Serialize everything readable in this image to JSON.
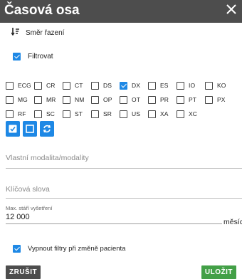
{
  "header": {
    "title": "Časová osa"
  },
  "sort": {
    "label": "Směr řazení"
  },
  "filter": {
    "label": "Filtrovat",
    "checked": true
  },
  "modalities": [
    {
      "label": "ECG",
      "checked": false
    },
    {
      "label": "CR",
      "checked": false
    },
    {
      "label": "CT",
      "checked": false
    },
    {
      "label": "DS",
      "checked": false
    },
    {
      "label": "DX",
      "checked": true
    },
    {
      "label": "ES",
      "checked": false
    },
    {
      "label": "IO",
      "checked": false
    },
    {
      "label": "KO",
      "checked": false
    },
    {
      "label": "MG",
      "checked": false
    },
    {
      "label": "MR",
      "checked": false
    },
    {
      "label": "NM",
      "checked": false
    },
    {
      "label": "OP",
      "checked": false
    },
    {
      "label": "OT",
      "checked": false
    },
    {
      "label": "PR",
      "checked": false
    },
    {
      "label": "PT",
      "checked": false
    },
    {
      "label": "PX",
      "checked": false
    },
    {
      "label": "RF",
      "checked": false
    },
    {
      "label": "SC",
      "checked": false
    },
    {
      "label": "ST",
      "checked": false
    },
    {
      "label": "SR",
      "checked": false
    },
    {
      "label": "US",
      "checked": false
    },
    {
      "label": "XA",
      "checked": false
    },
    {
      "label": "XC",
      "checked": false
    }
  ],
  "action_icons": [
    "select-all-icon",
    "deselect-all-icon",
    "reset-icon"
  ],
  "custom_modality": {
    "placeholder": "Vlastní modalita/modality",
    "value": ""
  },
  "keywords": {
    "placeholder": "Klíčová slova",
    "value": ""
  },
  "max_age": {
    "label": "Max. stáří vyšetření",
    "value": "12 000",
    "unit": "měsíců"
  },
  "disable_filters": {
    "label": "Vypnout filtry při změně pacienta",
    "checked": true
  },
  "footer": {
    "cancel": "ZRUŠIT",
    "save": "ULOŽIT"
  },
  "colors": {
    "header": "#4d4d4d",
    "accent": "#1e88e5",
    "save": "#43a047",
    "cancel": "#4d4d4d"
  }
}
